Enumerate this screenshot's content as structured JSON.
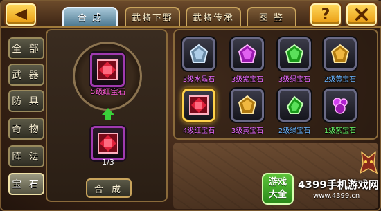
{
  "header": {
    "back_icon": "back-arrow-icon",
    "tabs": [
      {
        "label": "合 成",
        "active": true
      },
      {
        "label": "武将下野",
        "active": false
      },
      {
        "label": "武将传承",
        "active": false
      },
      {
        "label": "图 鉴",
        "active": false
      }
    ],
    "help_label": "?",
    "close_icon": "close-icon"
  },
  "sidebar": {
    "items": [
      {
        "label": "全 部",
        "active": false
      },
      {
        "label": "武 器",
        "active": false
      },
      {
        "label": "防 具",
        "active": false
      },
      {
        "label": "奇 物",
        "active": false
      },
      {
        "label": "阵 法",
        "active": false
      },
      {
        "label": "宝 石",
        "active": true
      }
    ]
  },
  "synthesis": {
    "result_label": "5级红宝石",
    "result_gem": "red-ruby",
    "material_gem": "red-ruby",
    "material_count": "1/3",
    "compose_label": "合 成"
  },
  "gems": [
    {
      "label": "3级水晶石",
      "color": "blue-crystal",
      "label_color": "purple",
      "selected": false
    },
    {
      "label": "3级紫宝石",
      "color": "purple",
      "label_color": "purple",
      "selected": false
    },
    {
      "label": "3级绿宝石",
      "color": "green",
      "label_color": "purple",
      "selected": false
    },
    {
      "label": "2级黄宝石",
      "color": "yellow",
      "label_color": "blue",
      "selected": false
    },
    {
      "label": "4级红宝石",
      "color": "red",
      "label_color": "purple",
      "selected": true
    },
    {
      "label": "3级黄宝石",
      "color": "yellow",
      "label_color": "purple",
      "selected": false
    },
    {
      "label": "2级绿宝石",
      "color": "green",
      "label_color": "blue",
      "selected": false
    },
    {
      "label": "1级紫宝石",
      "color": "purple",
      "label_color": "green",
      "selected": false
    }
  ],
  "watermark": {
    "badge_line1": "游戏",
    "badge_line2": "大全",
    "main": "4399手机游戏网",
    "url": "www.4399.cn"
  },
  "colors": {
    "accent_gold": "#e89a10",
    "tab_active": "#4e7a92",
    "label_purple": "#e86aff",
    "label_blue": "#6ab4ff",
    "label_green": "#6aff6a",
    "label_pink": "#ff5ad8"
  }
}
